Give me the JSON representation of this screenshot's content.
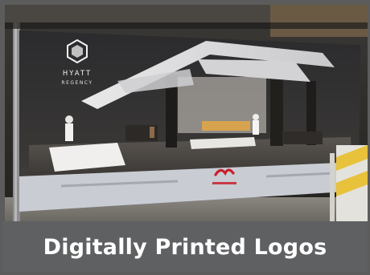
{
  "caption": "Digitally Printed Logos",
  "banner": {
    "brand_line1": "HYATT",
    "brand_line2": "REGENCY"
  },
  "colors": {
    "frame": "#5c5c5c",
    "caption_bar": "#5f6062",
    "caption_text": "#ffffff",
    "banner_stripe": "#c9ccd3",
    "barricade_yellow": "#e7c23a",
    "logo_red": "#c8202b"
  },
  "icons": {
    "hotel_logo": "hexagon-logo-icon",
    "sponsor_logo": "red-script-logo-icon"
  }
}
